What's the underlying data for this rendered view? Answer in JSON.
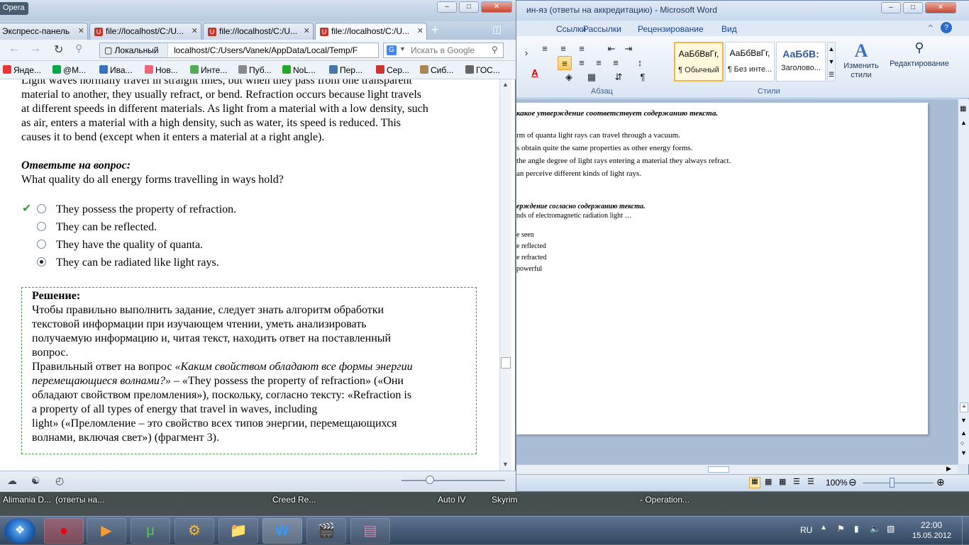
{
  "desktop": {
    "labels": [
      "Alimania D...",
      "(ответы на...",
      "Creed Re...",
      "Auto IV",
      "Skyrim",
      "- Operation..."
    ]
  },
  "word": {
    "title": "ин-яз (ответы на аккредитацию)  -  Microsoft Word",
    "tabs": [
      "Ссылки",
      "Рассылки",
      "Рецензирование",
      "Вид"
    ],
    "group_paragraph": "Абзац",
    "group_styles": "Стили",
    "styles": [
      {
        "sample": "АаБбВвГг,",
        "name": "¶ Обычный"
      },
      {
        "sample": "АаБбВвГг,",
        "name": "¶ Без инте..."
      },
      {
        "sample": "АаБбВ:",
        "name": "Заголово..."
      }
    ],
    "change_styles": "Изменить стили",
    "editing": "Редактирование",
    "doc_lines": [
      "какое утверждение соответствует содержанию текста.",
      "rm of quanta light rays can travel through a vacuum.",
      "s obtain quite the same properties as other energy forms.",
      "the angle degree of light rays entering a material they always refract.",
      "an perceive different kinds of light rays.",
      "ерждение согласно содержанию текста.",
      "nds of electromagnetic radiation light …",
      "e seen",
      "e reflected",
      "e refracted",
      "powerful"
    ],
    "zoom": "100%"
  },
  "opera": {
    "logo": "Opera",
    "tabs": [
      {
        "label": "Экспресс-панель"
      },
      {
        "label": "file://localhost/C:/U..."
      },
      {
        "label": "file://localhost/C:/U..."
      },
      {
        "label": "file://localhost/C:/U..."
      }
    ],
    "address_mode": "Локальный",
    "address": "localhost/C:/Users/Vanek/AppData/Local/Temp/F",
    "search_placeholder": "Искать в Google",
    "bookmarks": [
      "Янде...",
      "@M...",
      "Ива...",
      "Нов...",
      "Инте...",
      "Пуб...",
      "NoL...",
      "Пер...",
      "Сер...",
      "Сиб...",
      "ГОС..."
    ]
  },
  "page": {
    "passage": [
      "Light waves normally travel in straight lines, but when they pass from one transparent",
      "material to another, they usually refract, or bend. Refraction occurs because light travels",
      "at different speeds in different materials. As light from a material with a low density, such",
      "as air, enters a material with a high density, such as water, its speed is reduced. This",
      "causes it to bend (except when it enters a material at a right angle)."
    ],
    "question_heading": "Ответьте на вопрос:",
    "question": "What quality do all energy forms travelling in ways hold?",
    "options": [
      {
        "text": "They possess the property of refraction.",
        "correct": true,
        "selected": false
      },
      {
        "text": "They can be reflected.",
        "correct": false,
        "selected": false
      },
      {
        "text": "They have the quality of quanta.",
        "correct": false,
        "selected": false
      },
      {
        "text": "They can be radiated like light rays.",
        "correct": false,
        "selected": true
      }
    ],
    "solution_heading": "Решение:",
    "solution_p1": [
      "Чтобы правильно выполнить задание, следует знать алгоритм обработки",
      "текстовой информации при изучающем чтении, уметь анализировать",
      "получаемую информацию и, читая текст, находить ответ на поставленный",
      "вопрос."
    ],
    "solution_p2_prefix": "Правильный ответ на вопрос ",
    "solution_p2_italic": "«Каким свойством обладают все формы энергии",
    "solution_p2_italic2": "перемещающиеся волнами?»",
    "solution_p2_rest": [
      " – «They possess the property of refraction» («Они",
      "обладают свойством преломления»), поскольку, согласно тексту: «Refraction is",
      "a property of all types of energy that travel in waves, including",
      "light» («Преломление – это свойство всех типов энергии, перемещающихся",
      "волнами, включая свет») (фрагмент 3)."
    ]
  },
  "taskbar": {
    "lang": "RU",
    "time": "22:00",
    "date": "15.05.2012"
  }
}
